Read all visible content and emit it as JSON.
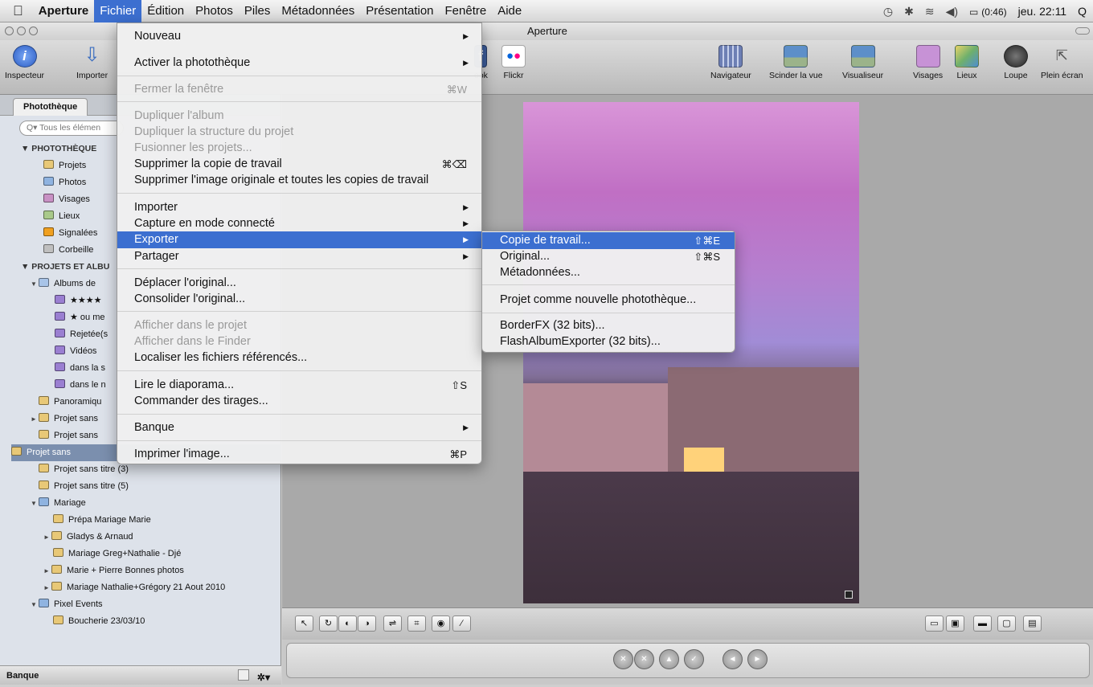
{
  "menubar": {
    "apple": "",
    "app": "Aperture",
    "items": [
      "Fichier",
      "Édition",
      "Photos",
      "Piles",
      "Métadonnées",
      "Présentation",
      "Fenêtre",
      "Aide"
    ],
    "battery": "(0:46)",
    "clock": "jeu. 22:11",
    "search_glyph": "Q"
  },
  "window": {
    "title": "Aperture"
  },
  "toolbar": {
    "inspector": "Inspecteur",
    "import": "Importer",
    "facebook": "ook",
    "flickr": "Flickr",
    "navigator": "Navigateur",
    "split": "Scinder la vue",
    "viewer": "Visualiseur",
    "faces": "Visages",
    "places": "Lieux",
    "loupe": "Loupe",
    "fullscreen": "Plein écran"
  },
  "sidebar": {
    "tab": "Photothèque",
    "search_placeholder": "Q▾ Tous les élémen",
    "library_header": "▼ PHOTOTHÈQUE",
    "library": [
      {
        "label": "Projets",
        "color": "#e8c877"
      },
      {
        "label": "Photos",
        "color": "#8fb3e0"
      },
      {
        "label": "Visages",
        "color": "#c891c4"
      },
      {
        "label": "Lieux",
        "color": "#a9c98a"
      },
      {
        "label": "Signalées",
        "color": "#f0a020"
      },
      {
        "label": "Corbeille",
        "color": "#bfbfbf"
      }
    ],
    "projects_header": "▼ PROJETS ET ALBU",
    "albums_root": "Albums de",
    "albums": [
      "★★★★",
      "★ ou me",
      "Rejetée(s",
      "Vidéos",
      "dans la s",
      "dans le n"
    ],
    "projects": [
      {
        "label": "Panoramiqu",
        "tri": ""
      },
      {
        "label": "Projet sans",
        "tri": "►"
      },
      {
        "label": "Projet sans",
        "tri": ""
      },
      {
        "label": "Projet sans",
        "tri": "",
        "selected": true
      },
      {
        "label": "Projet sans titre (3)",
        "tri": ""
      },
      {
        "label": "Projet sans titre (5)",
        "tri": ""
      }
    ],
    "folders": [
      {
        "label": "Mariage",
        "children": [
          {
            "label": "Prépa Mariage Marie",
            "tri": ""
          },
          {
            "label": "Gladys & Arnaud",
            "tri": "►"
          },
          {
            "label": "Mariage Greg+Nathalie - Djé",
            "tri": ""
          },
          {
            "label": "Marie + Pierre Bonnes photos",
            "tri": "►"
          },
          {
            "label": "Mariage Nathalie+Grégory 21 Aout 2010",
            "tri": "►"
          }
        ]
      },
      {
        "label": "Pixel Events",
        "children": [
          {
            "label": "Boucherie 23/03/10",
            "tri": ""
          }
        ]
      }
    ],
    "footer": "Banque"
  },
  "fichier_menu": {
    "nouveau": "Nouveau",
    "activer": "Activer la photothèque",
    "fermer": "Fermer la fenêtre",
    "fermer_sc": "⌘W",
    "dup_album": "Dupliquer l'album",
    "dup_struct": "Dupliquer la structure du projet",
    "fusionner": "Fusionner les projets...",
    "suppr_copie": "Supprimer la copie de travail",
    "suppr_copie_sc": "⌘⌫",
    "suppr_orig": "Supprimer l'image originale et toutes les copies de travail",
    "importer": "Importer",
    "capture": "Capture en mode connecté",
    "exporter": "Exporter",
    "partager": "Partager",
    "deplacer": "Déplacer l'original...",
    "consolider": "Consolider l'original...",
    "afficher_projet": "Afficher dans le projet",
    "afficher_finder": "Afficher dans le Finder",
    "localiser": "Localiser les fichiers référencés...",
    "diaporama": "Lire le diaporama...",
    "diaporama_sc": "⇧S",
    "tirages": "Commander des tirages...",
    "banque": "Banque",
    "imprimer": "Imprimer l'image...",
    "imprimer_sc": "⌘P"
  },
  "export_submenu": {
    "copie": "Copie de travail...",
    "copie_sc": "⇧⌘E",
    "original": "Original...",
    "original_sc": "⇧⌘S",
    "meta": "Métadonnées...",
    "projet": "Projet comme nouvelle photothèque...",
    "borderfx": "BorderFX (32 bits)...",
    "flash": "FlashAlbumExporter (32 bits)..."
  },
  "viewer_tools": [
    "↖",
    "↻",
    "◐",
    "◑",
    "⇌",
    "⌗",
    "◉",
    "∕",
    "▭",
    "▣",
    "▬",
    "▢",
    "▤"
  ],
  "controls": [
    "✕",
    "✕",
    "▲",
    "✓",
    "◄",
    "►"
  ],
  "colors": {
    "accent": "#3c6fd0",
    "sidebar": "#dde2ea",
    "selection": "#7b8fae"
  }
}
